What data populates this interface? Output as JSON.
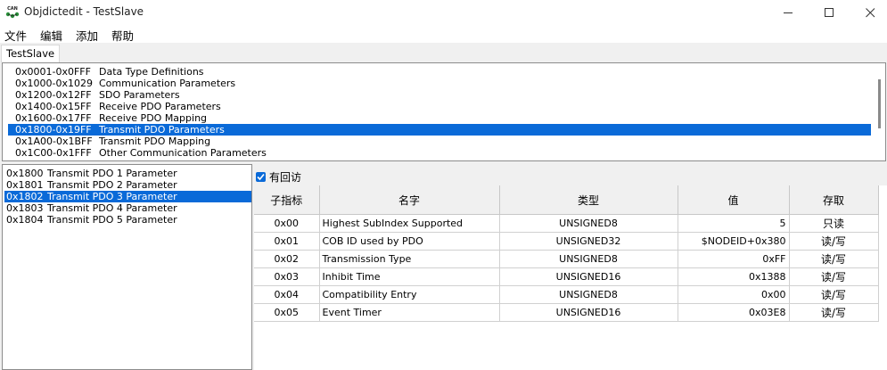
{
  "window": {
    "title": "Objdictedit - TestSlave",
    "icon_text": "CAN"
  },
  "menu": [
    "文件",
    "编辑",
    "添加",
    "帮助"
  ],
  "tab": "TestSlave",
  "ranges": [
    {
      "code": "0x0001-0x0FFF",
      "desc": "Data Type Definitions"
    },
    {
      "code": "0x1000-0x1029",
      "desc": "Communication Parameters"
    },
    {
      "code": "0x1200-0x12FF",
      "desc": "SDO Parameters"
    },
    {
      "code": "0x1400-0x15FF",
      "desc": "Receive PDO Parameters"
    },
    {
      "code": "0x1600-0x17FF",
      "desc": "Receive PDO Mapping"
    },
    {
      "code": "0x1800-0x19FF",
      "desc": "Transmit PDO Parameters"
    },
    {
      "code": "0x1A00-0x1BFF",
      "desc": "Transmit PDO Mapping"
    },
    {
      "code": "0x1C00-0x1FFF",
      "desc": "Other Communication Parameters"
    }
  ],
  "selected_range": 5,
  "indexes": [
    {
      "code": "0x1800",
      "desc": "Transmit PDO 1 Parameter"
    },
    {
      "code": "0x1801",
      "desc": "Transmit PDO 2 Parameter"
    },
    {
      "code": "0x1802",
      "desc": "Transmit PDO 3 Parameter"
    },
    {
      "code": "0x1803",
      "desc": "Transmit PDO 4 Parameter"
    },
    {
      "code": "0x1804",
      "desc": "Transmit PDO 5 Parameter"
    }
  ],
  "selected_index": 2,
  "callback": {
    "label": "有回访",
    "checked": true
  },
  "table": {
    "headers": [
      "子指标",
      "名字",
      "类型",
      "值",
      "存取"
    ],
    "rows": [
      [
        "0x00",
        "Highest SubIndex Supported",
        "UNSIGNED8",
        "5",
        "只读"
      ],
      [
        "0x01",
        "COB ID used by PDO",
        "UNSIGNED32",
        "$NODEID+0x380",
        "读/写"
      ],
      [
        "0x02",
        "Transmission Type",
        "UNSIGNED8",
        "0xFF",
        "读/写"
      ],
      [
        "0x03",
        "Inhibit Time",
        "UNSIGNED16",
        "0x1388",
        "读/写"
      ],
      [
        "0x04",
        "Compatibility Entry",
        "UNSIGNED8",
        "0x00",
        "读/写"
      ],
      [
        "0x05",
        "Event Timer",
        "UNSIGNED16",
        "0x03E8",
        "读/写"
      ]
    ]
  },
  "colors": {
    "selection": "#0a6ad8"
  }
}
